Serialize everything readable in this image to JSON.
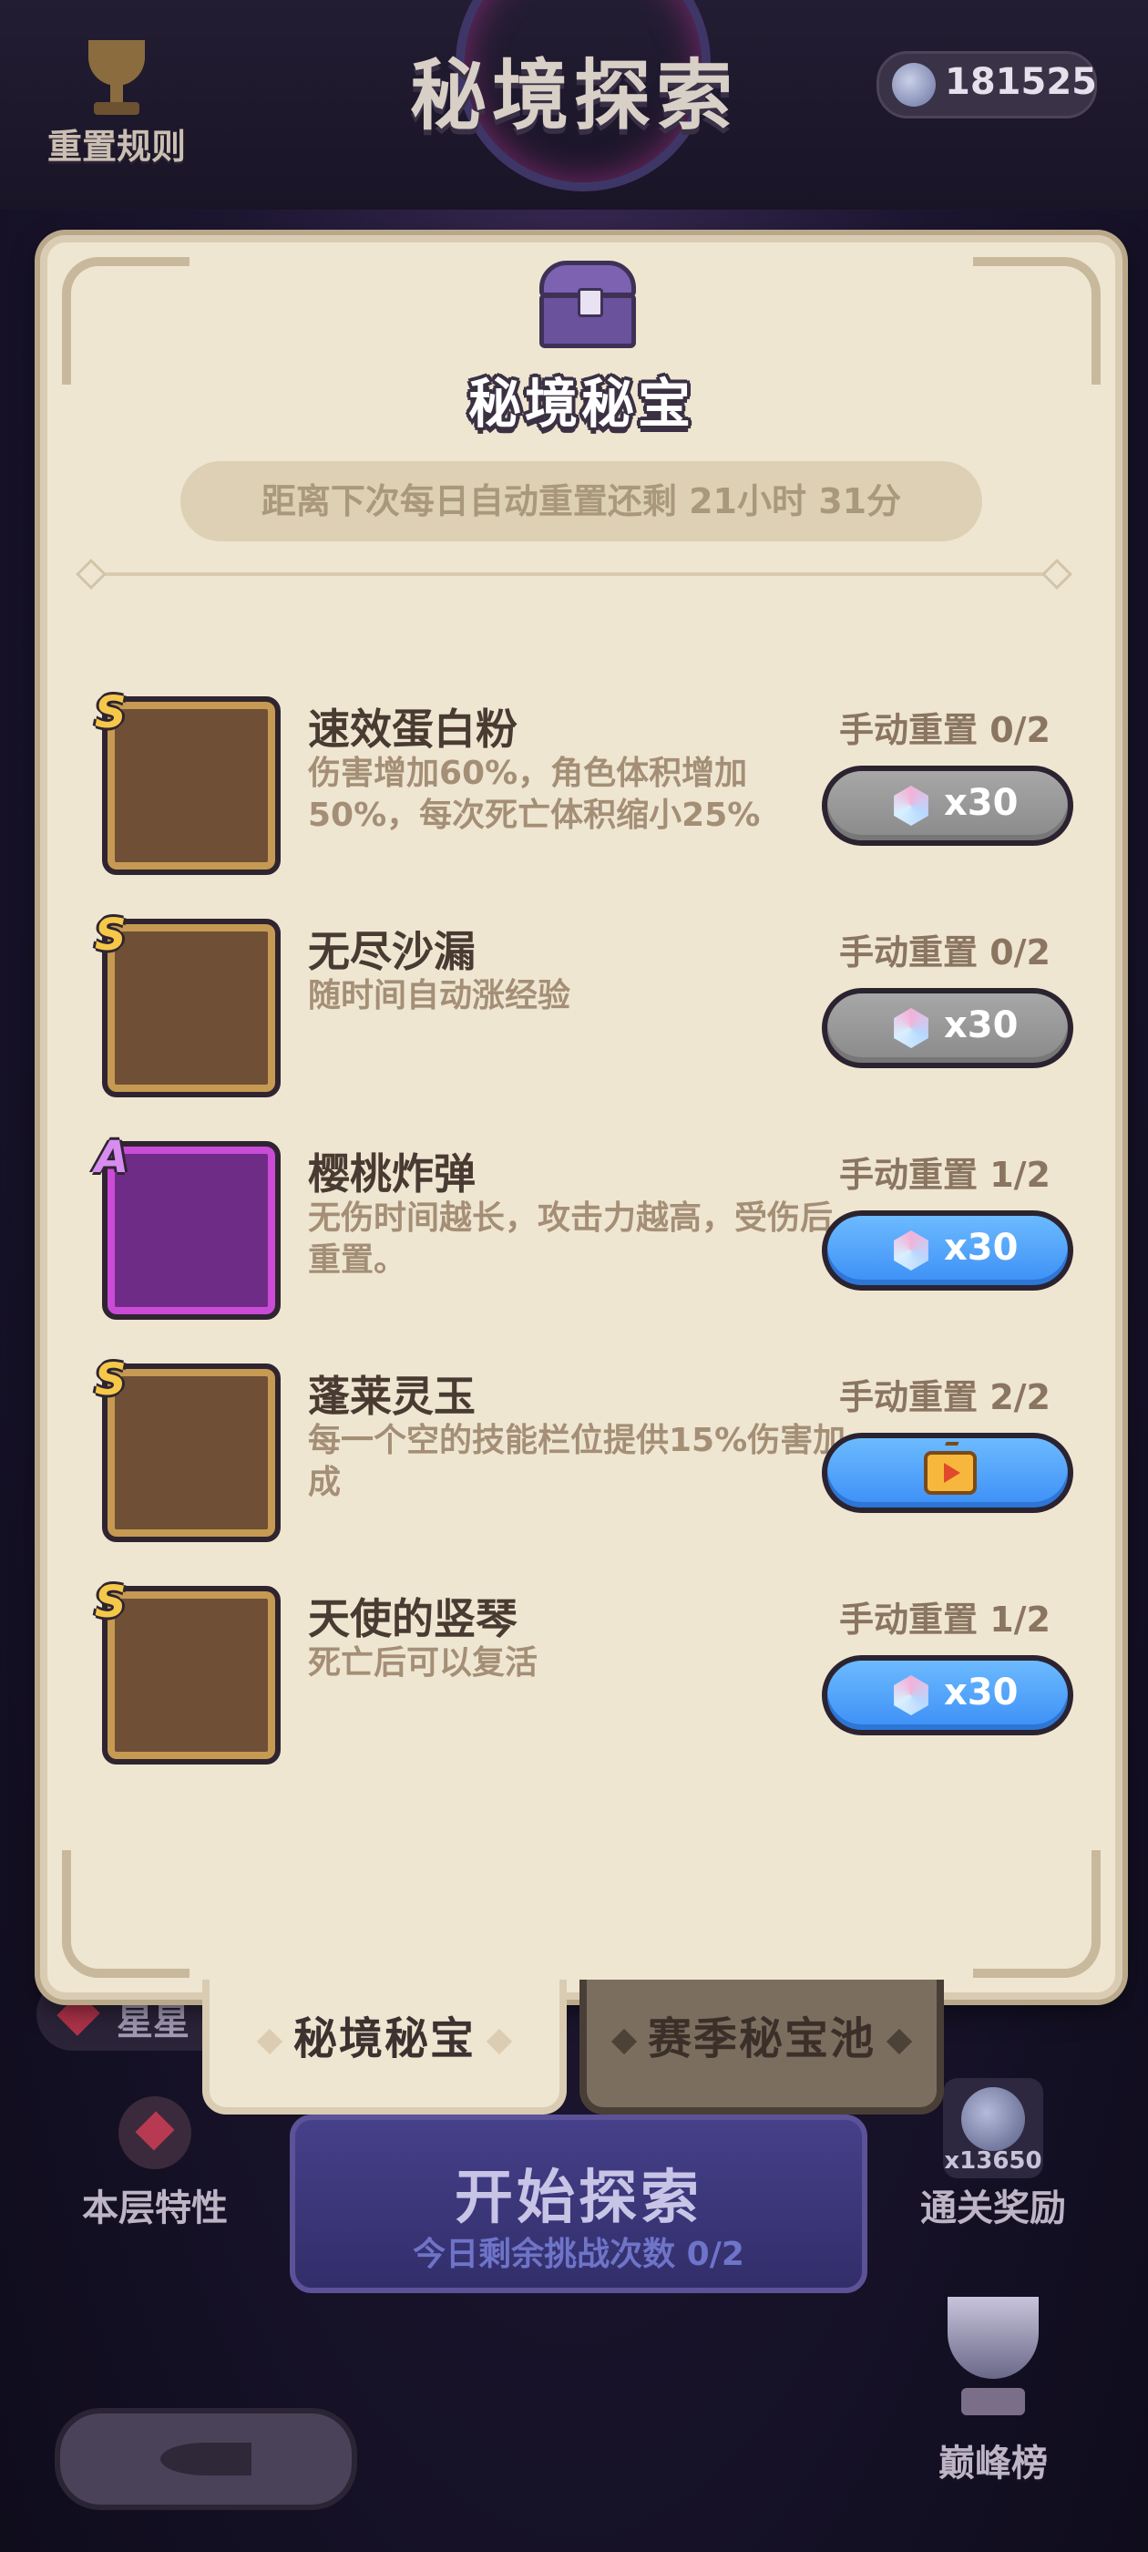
{
  "header": {
    "title": "秘境探索",
    "currency_value": "181525",
    "reset_rules_label": "重置规则"
  },
  "modal": {
    "title": "秘境秘宝",
    "reset_timer": "距离下次每日自动重置还剩 21小时 31分",
    "items": [
      {
        "rank": "S",
        "name": "速效蛋白粉",
        "desc": "伤害增加60%，角色体积增加50%，每次死亡体积缩小25%",
        "manual_reset": "手动重置 0/2",
        "cost": "x30",
        "button_state": "disabled",
        "icon": "protein-powder-icon"
      },
      {
        "rank": "S",
        "name": "无尽沙漏",
        "desc": "随时间自动涨经验",
        "manual_reset": "手动重置 0/2",
        "cost": "x30",
        "button_state": "disabled",
        "icon": "hourglass-icon"
      },
      {
        "rank": "A",
        "name": "樱桃炸弹",
        "desc": "无伤时间越长，攻击力越高，受伤后重置。",
        "manual_reset": "手动重置 1/2",
        "cost": "x30",
        "button_state": "enabled",
        "icon": "cherry-bomb-icon"
      },
      {
        "rank": "S",
        "name": "蓬莱灵玉",
        "desc": "每一个空的技能栏位提供15%伤害加成",
        "manual_reset": "手动重置 2/2",
        "cost": "",
        "button_state": "watch-ad",
        "icon": "jade-icon"
      },
      {
        "rank": "S",
        "name": "天使的竖琴",
        "desc": "死亡后可以复活",
        "manual_reset": "手动重置 1/2",
        "cost": "x30",
        "button_state": "enabled",
        "icon": "lyre-icon"
      }
    ]
  },
  "tabs": [
    {
      "label": "秘境秘宝",
      "active": true
    },
    {
      "label": "赛季秘宝池",
      "active": false
    }
  ],
  "background": {
    "star_label": "星星",
    "layer_trait_label": "本层特性",
    "start_button_label": "开始探索",
    "start_button_sub": "今日剩余挑战次数 0/2",
    "clear_reward_label": "通关奖励",
    "clear_reward_count": "x13650",
    "peak_rank_label": "巅峰榜"
  },
  "colors": {
    "panel_bg": "#efe6d2",
    "button_enabled": "#4a9cff",
    "button_disabled": "#9a9a9a",
    "rank_s": "#f6c84a",
    "rank_a": "#d78cf0"
  }
}
